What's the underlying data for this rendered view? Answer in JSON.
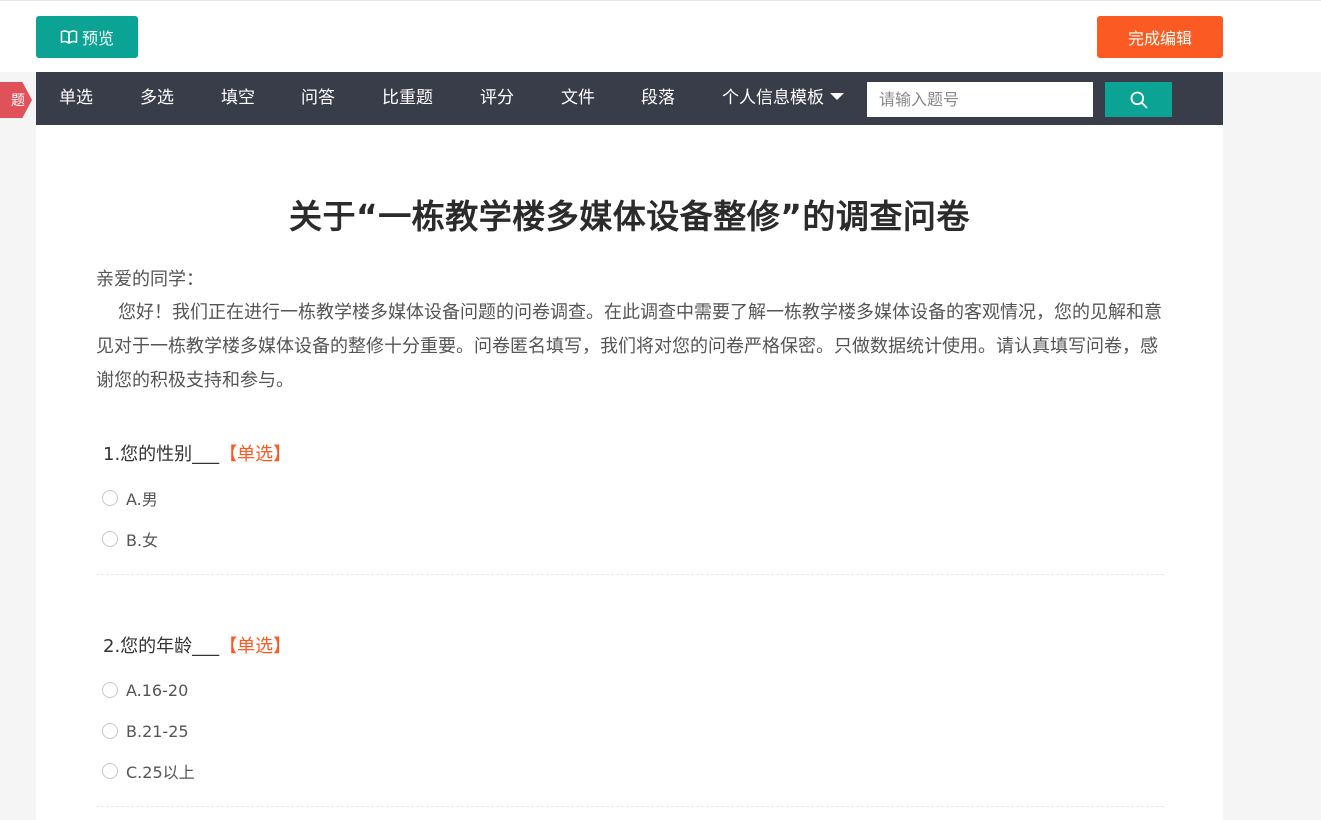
{
  "header": {
    "preview_label": "预览",
    "finish_label": "完成编辑"
  },
  "side_tag": {
    "label": "题"
  },
  "toolbar": {
    "items": [
      "单选",
      "多选",
      "填空",
      "问答",
      "比重题",
      "评分",
      "文件",
      "段落",
      "个人信息模板"
    ],
    "search_placeholder": "请输入题号"
  },
  "survey": {
    "title": "关于“一栋教学楼多媒体设备整修”的调查问卷",
    "greeting": "亲爱的同学：",
    "intro": "您好！我们正在进行一栋教学楼多媒体设备问题的问卷调查。在此调查中需要了解一栋教学楼多媒体设备的客观情况，您的见解和意见对于一栋教学楼多媒体设备的整修十分重要。问卷匿名填写，我们将对您的问卷严格保密。只做数据统计使用。请认真填写问卷，感谢您的积极支持和参与。",
    "questions": [
      {
        "title": "1.您的性别___",
        "type": "【单选】",
        "options": [
          "A.男",
          "B.女"
        ]
      },
      {
        "title": "2.您的年龄___",
        "type": "【单选】",
        "options": [
          "A.16-20",
          "B.21-25",
          "C.25以上"
        ]
      }
    ]
  },
  "colors": {
    "accent": "#0aa394",
    "finish": "#fc5a23",
    "toolbar_bg": "#393d49",
    "question_type": "#fc5a23",
    "side_tag": "#e0525a"
  }
}
